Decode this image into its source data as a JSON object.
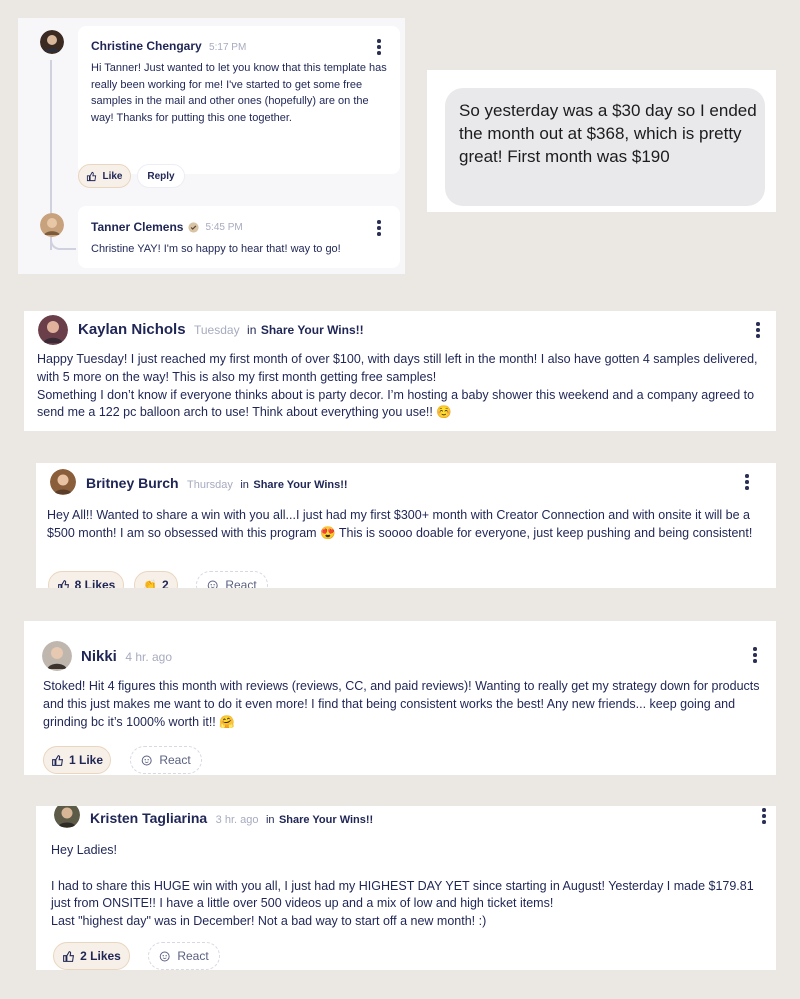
{
  "thread": {
    "comment": {
      "author": "Christine Chengary",
      "time": "5:17 PM",
      "text": "Hi Tanner! Just wanted to let you know that this template has really been working for me! I've started to get some free samples in the mail and other ones (hopefully) are on the way! Thanks for putting this one together.",
      "like_label": "Like",
      "reply_label": "Reply"
    },
    "reply": {
      "author": "Tanner Clemens",
      "time": "5:45 PM",
      "text": "Christine YAY! I'm so happy to hear that! way to go!"
    }
  },
  "message_bubble": {
    "text": "So yesterday was a $30 day so I ended the month out at $368, which is pretty great! First month was $190"
  },
  "posts": [
    {
      "author": "Kaylan Nichols",
      "time": "Tuesday",
      "in_label": "in",
      "channel": "Share Your Wins!!",
      "text": "Happy Tuesday! I just reached my first month of over $100, with days still left in the month! I also have gotten 4 samples delivered, with 5 more on the way! This is also my first month getting free samples!\nSomething I don’t know if everyone thinks about is party decor. I’m hosting a baby shower this weekend and a company agreed to send me a 122 pc balloon arch to use! Think about everything you use!! ☺️"
    },
    {
      "author": "Britney Burch",
      "time": "Thursday",
      "in_label": "in",
      "channel": "Share Your Wins!!",
      "text": "Hey All!! Wanted to share a win with you all...I just had my first $300+ month with Creator Connection and with onsite it will be a $500 month! I am so obsessed with this program 😍 This is soooo doable for everyone, just keep pushing and being consistent!",
      "likes_label": "8 Likes",
      "reaction_emoji": "👏",
      "reaction_count": "2",
      "react_label": "React"
    },
    {
      "author": "Nikki",
      "time": "4 hr. ago",
      "text": "Stoked! Hit 4 figures this month with reviews (reviews, CC, and paid reviews)! Wanting to really get my strategy down for products and this just makes me want to do it even more! I find that being consistent works the best! Any new friends... keep going and grinding bc it’s 1000% worth it!! 🤗",
      "likes_label": "1 Like",
      "react_label": "React"
    },
    {
      "author": "Kristen Tagliarina",
      "time": "3 hr. ago",
      "in_label": "in",
      "channel": "Share Your Wins!!",
      "text": "Hey Ladies!\n\nI had to share this HUGE win with you all, I just had my HIGHEST DAY YET since starting in August! Yesterday I made $179.81 just from ONSITE!! I have a little over 500 videos up and a mix of low and high ticket items!\nLast \"highest day\" was in December! Not a bad way to start off a new month! :)",
      "likes_label": "2 Likes",
      "react_label": "React"
    }
  ],
  "icons": {
    "like": "thumbs-up-icon",
    "react": "smiley-plus-icon",
    "more": "more-vertical-icon",
    "verified": "verified-badge-icon"
  },
  "colors": {
    "page_bg": "#ebe7e3",
    "text_navy": "#1f2655",
    "muted": "#a7abbf",
    "pill_bg": "#f7f0e9",
    "pill_border": "#e9d6bf",
    "bubble_bg": "#e9e9eb"
  }
}
